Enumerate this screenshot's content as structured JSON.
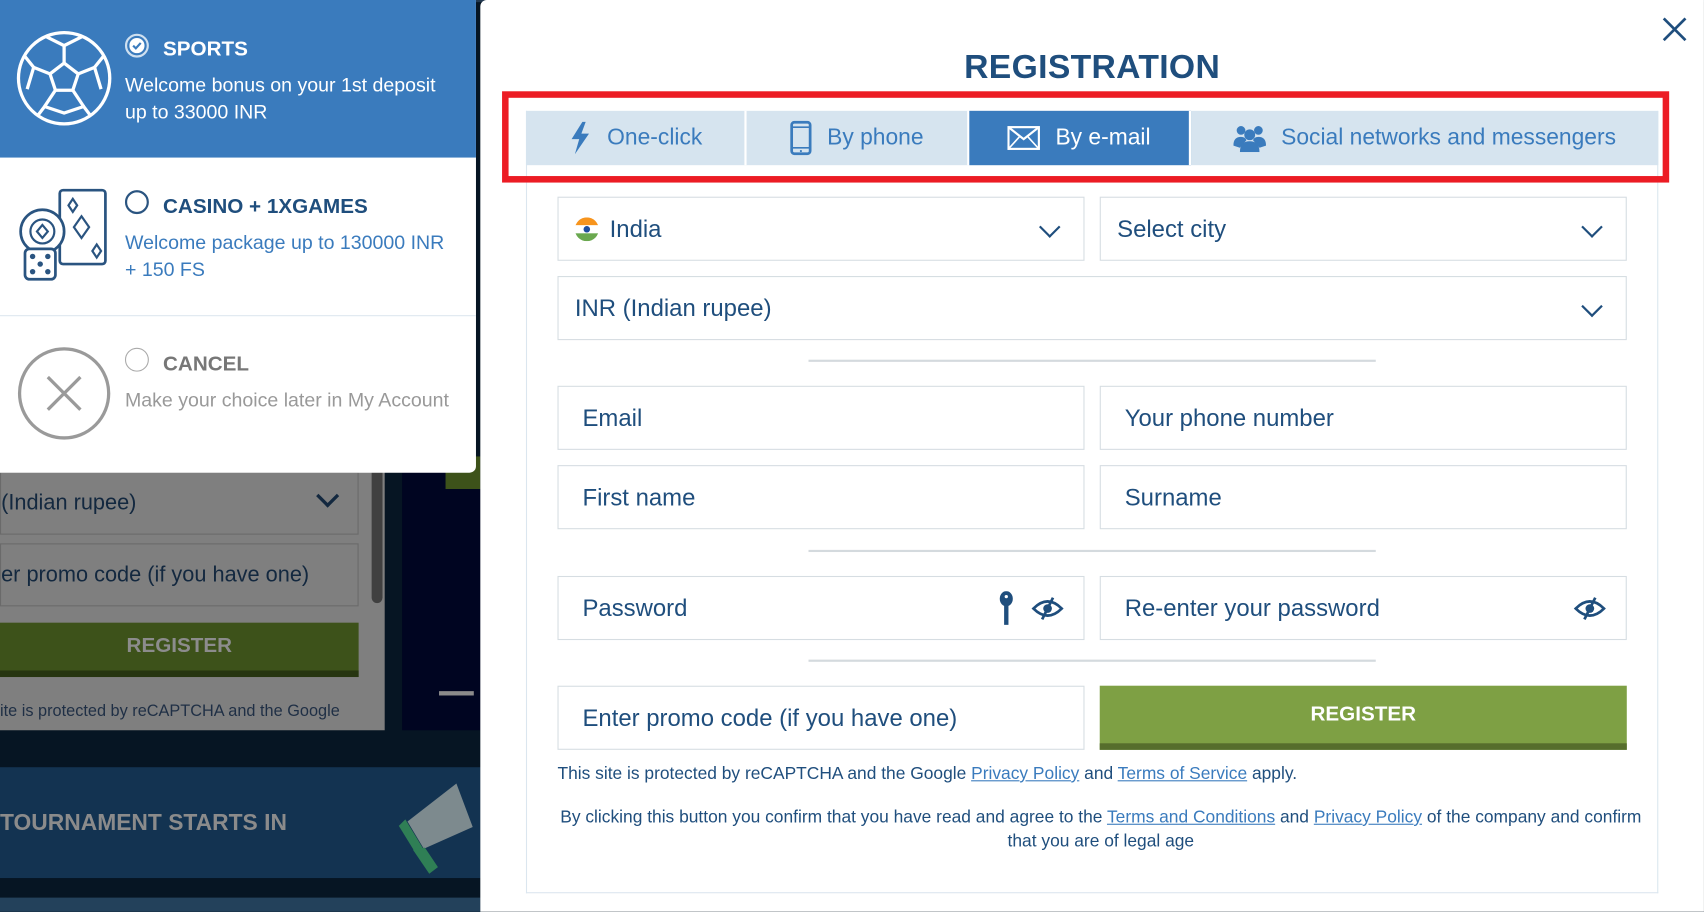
{
  "background": {
    "currency_value": "(Indian rupee)",
    "promo_placeholder": "er promo code (if you have one)",
    "register_label": "REGISTER",
    "recaptcha_text": "ite is protected by reCAPTCHA and the Google",
    "banner_text": "TOURNAMENT STARTS IN"
  },
  "bonus_picker": {
    "options": [
      {
        "title": "SPORTS",
        "description": "Welcome bonus on your 1st deposit up to 33000 INR",
        "selected": true,
        "icon": "soccer-ball-icon"
      },
      {
        "title": "CASINO + 1XGAMES",
        "description": "Welcome package up to 130000 INR + 150 FS",
        "selected": false,
        "icon": "casino-chips-cards-icon"
      },
      {
        "title": "CANCEL",
        "description": "Make your choice later in My Account",
        "selected": false,
        "icon": "cancel-x-icon"
      }
    ]
  },
  "modal": {
    "title": "REGISTRATION",
    "close_icon": "close-icon",
    "tabs": [
      {
        "label": "One-click",
        "icon": "lightning-icon",
        "active": false
      },
      {
        "label": "By phone",
        "icon": "mobile-phone-icon",
        "active": false
      },
      {
        "label": "By e-mail",
        "icon": "envelope-icon",
        "active": true
      },
      {
        "label": "Social networks and messengers",
        "icon": "users-group-icon",
        "active": false
      }
    ],
    "fields": {
      "country": "India",
      "city_placeholder": "Select city",
      "currency": "INR (Indian rupee)",
      "email_placeholder": "Email",
      "phone_placeholder": "Your phone number",
      "first_name_placeholder": "First name",
      "surname_placeholder": "Surname",
      "password_placeholder": "Password",
      "reenter_password_placeholder": "Re-enter your password",
      "promo_placeholder": "Enter promo code (if you have one)"
    },
    "register_label": "REGISTER",
    "legal": {
      "recaptcha_prefix": "This site is protected by reCAPTCHA and the Google ",
      "privacy_policy": "Privacy Policy",
      "and": " and ",
      "terms_of_service": "Terms of Service",
      "apply": " apply.",
      "consent_prefix": "By clicking this button you confirm that you have read and agree to the ",
      "terms_and_conditions": "Terms and Conditions",
      "consent_and": " and ",
      "privacy_policy_2": "Privacy Policy",
      "consent_suffix": " of the company and confirm that you are of legal age"
    }
  },
  "colors": {
    "brand_blue": "#3a7bbd",
    "text_navy": "#1f4e7d",
    "register_green": "#7ea044",
    "highlight_red": "#ec1c24",
    "tab_bg": "#d6e4ef"
  }
}
